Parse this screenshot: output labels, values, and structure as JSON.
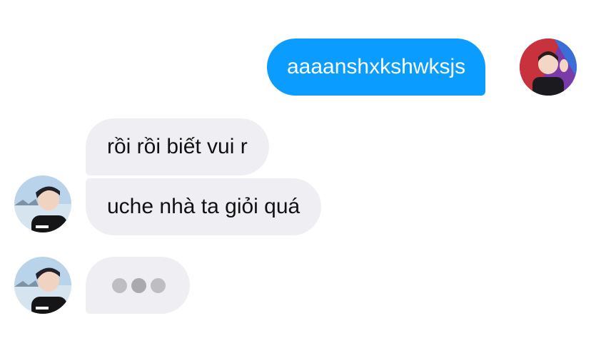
{
  "conversation": {
    "outgoing": [
      {
        "text": "aaaanshxkshwksjs"
      }
    ],
    "incoming": [
      {
        "text": "rồi rồi biết vui r"
      },
      {
        "text": "uche nhà ta giỏi quá"
      }
    ],
    "typing_indicator": {
      "dot_count": 3
    }
  },
  "colors": {
    "outgoing_bubble": "#0a9cff",
    "incoming_bubble": "#efeff3",
    "outgoing_text": "#ffffff",
    "incoming_text": "#111111",
    "typing_dot": "#bdbdc2",
    "typing_dot_active": "#a9a9ae"
  },
  "icons": {
    "self_avatar": "self-avatar",
    "contact_avatar": "contact-avatar"
  }
}
